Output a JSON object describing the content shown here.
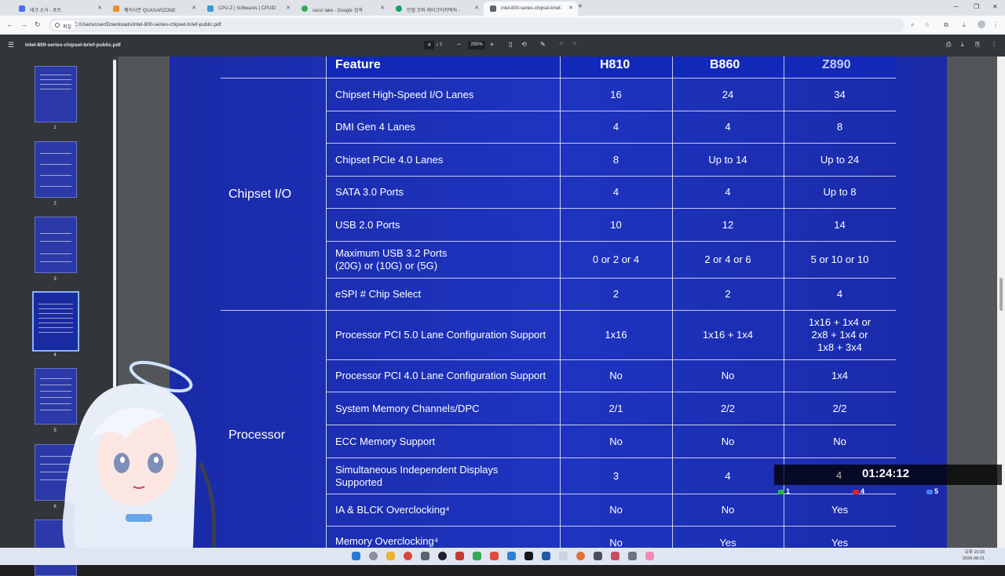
{
  "browser": {
    "tabs": [
      {
        "label": "테크 소식 - 포트",
        "color": "#4e6ef2"
      },
      {
        "label": "퀘이사존 QUASARZONE",
        "color": "#f08a24"
      },
      {
        "label": "CPU-Z | Softwares | CPUID",
        "color": "#3a9bd5"
      },
      {
        "label": "razor lake - Google 검색",
        "color": "#34a853"
      },
      {
        "label": "인텔 코퍼 레이크아키텍처 -",
        "color": "#1aa260"
      },
      {
        "label": "intel-800-series-chipset-brief-",
        "color": "#5f6368"
      }
    ],
    "url_chip": "파일",
    "url": "C:/Users/user/Downloads/intel-800-series-chipset-brief-public.pdf"
  },
  "pdf": {
    "filename": "intel-800-series-chipset-brief-public.pdf",
    "page_current": "4",
    "page_total": "/ 7",
    "zoom": "250%",
    "thumbnails": [
      "1",
      "2",
      "3",
      "4",
      "5",
      "6"
    ]
  },
  "table": {
    "header": {
      "feature": "Feature",
      "h810": "H810",
      "b860": "B860",
      "z890": "Z890"
    },
    "categories": {
      "io": "Chipset I/O",
      "processor": "Processor"
    },
    "rows": [
      {
        "feature": "Chipset High-Speed I/O Lanes",
        "h810": "16",
        "b860": "24",
        "z890": "34"
      },
      {
        "feature": "DMI Gen 4 Lanes",
        "h810": "4",
        "b860": "4",
        "z890": "8"
      },
      {
        "feature": "Chipset PCIe 4.0 Lanes",
        "h810": "8",
        "b860": "Up to 14",
        "z890": "Up to 24"
      },
      {
        "feature": "SATA 3.0 Ports",
        "h810": "4",
        "b860": "4",
        "z890": "Up to 8"
      },
      {
        "feature": "USB 2.0 Ports",
        "h810": "10",
        "b860": "12",
        "z890": "14"
      },
      {
        "feature": "Maximum USB 3.2 Ports",
        "feature2": "(20G) or (10G) or (5G)",
        "h810": "0 or 2 or 4",
        "b860": "2 or 4 or 6",
        "z890": "5 or 10 or 10"
      },
      {
        "feature": "eSPI # Chip Select",
        "h810": "2",
        "b860": "2",
        "z890": "4"
      },
      {
        "feature": "Processor PCI 5.0 Lane Configuration Support",
        "h810": "1x16",
        "b860": "1x16 + 1x4",
        "z890": "1x16 + 1x4 or",
        "z890b": "2x8 + 1x4 or",
        "z890c": "1x8 + 3x4"
      },
      {
        "feature": "Processor PCI 4.0 Lane Configuration Support",
        "h810": "No",
        "b860": "No",
        "z890": "1x4"
      },
      {
        "feature": "System Memory Channels/DPC",
        "h810": "2/1",
        "b860": "2/2",
        "z890": "2/2"
      },
      {
        "feature": "ECC Memory Support",
        "h810": "No",
        "b860": "No",
        "z890": "No"
      },
      {
        "feature": "Simultaneous Independent Displays",
        "feature2": "Supported",
        "h810": "3",
        "b860": "4",
        "z890": "4"
      },
      {
        "feature": "IA & BLCK Overclocking⁴",
        "h810": "No",
        "b860": "No",
        "z890": "Yes"
      },
      {
        "feature": "Memory Overclocking⁴",
        "h810": "No",
        "b860": "Yes",
        "z890": "Yes"
      }
    ]
  },
  "stream_overlay": {
    "timer": "01:24:12",
    "stats": [
      {
        "value": "1",
        "color": "#2db34a"
      },
      {
        "value": "4",
        "color": "#e02020"
      },
      {
        "value": "5",
        "color": "#4a7ef0"
      }
    ]
  },
  "taskbar": {
    "time": "오후 10:33",
    "date": "2026-08-21"
  }
}
